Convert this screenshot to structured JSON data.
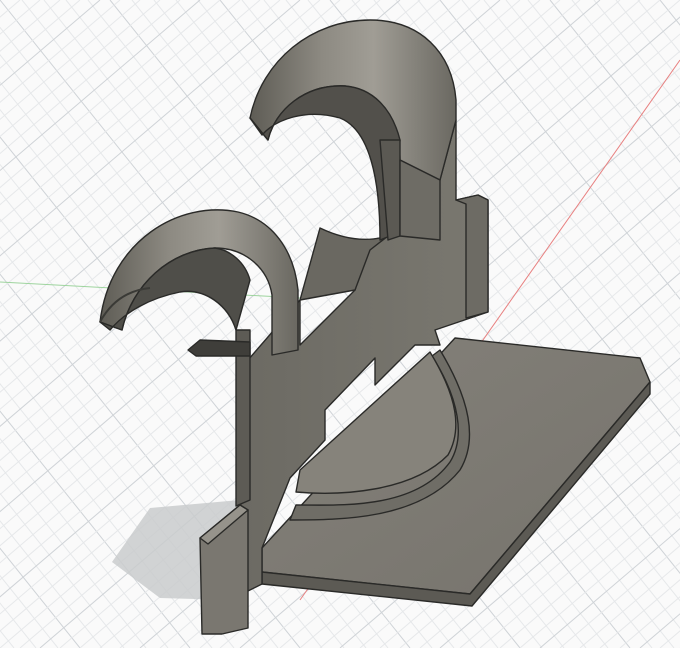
{
  "viewport": {
    "background": "#fafafa",
    "grid_minor_color": "#e6e8ea",
    "grid_major_color": "#cfd3d7",
    "x_axis_color": "#e88080",
    "y_axis_color": "#9ed49e",
    "model_color": "#7d7a72",
    "model_dark": "#5a5852",
    "model_light": "#908d84",
    "edge_color": "#2a2a28",
    "shadow_color": "#c9cbcd"
  }
}
